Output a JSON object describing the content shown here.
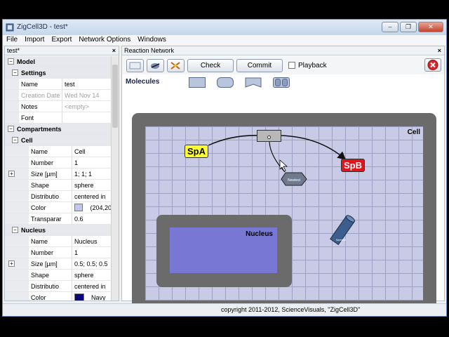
{
  "window": {
    "title": "ZigCell3D - test*"
  },
  "menu": [
    "File",
    "Import",
    "Export",
    "Network Options",
    "Windows"
  ],
  "left_panel": {
    "tab": "test*",
    "rows": [
      {
        "type": "group",
        "level": 0,
        "label": "Model"
      },
      {
        "type": "group",
        "level": 1,
        "label": "Settings"
      },
      {
        "type": "prop",
        "level": 1,
        "key": "Name",
        "value": "test"
      },
      {
        "type": "prop",
        "level": 1,
        "key": "Creation Date",
        "value": "Wed Nov 14",
        "muted": true
      },
      {
        "type": "prop",
        "level": 1,
        "key": "Notes",
        "value": "<empty>",
        "value_gray": true
      },
      {
        "type": "prop",
        "level": 1,
        "key": "Font",
        "value": ""
      },
      {
        "type": "group",
        "level": 0,
        "label": "Compartments"
      },
      {
        "type": "group",
        "level": 1,
        "label": "Cell"
      },
      {
        "type": "prop",
        "level": 2,
        "key": "Name",
        "value": "Cell"
      },
      {
        "type": "prop",
        "level": 2,
        "key": "Number",
        "value": "1"
      },
      {
        "type": "prop",
        "level": 2,
        "key": "Size [µm]",
        "value": "1; 1; 1",
        "expand": true
      },
      {
        "type": "prop",
        "level": 2,
        "key": "Shape",
        "value": "sphere"
      },
      {
        "type": "prop",
        "level": 2,
        "key": "Distributio",
        "value": "centered in"
      },
      {
        "type": "prop",
        "level": 2,
        "key": "Color",
        "value": "(204,20",
        "swatch": "#c4c6ee"
      },
      {
        "type": "prop",
        "level": 2,
        "key": "Transparar",
        "value": "0.6"
      },
      {
        "type": "group",
        "level": 1,
        "label": "Nucleus"
      },
      {
        "type": "prop",
        "level": 2,
        "key": "Name",
        "value": "Nucleus"
      },
      {
        "type": "prop",
        "level": 2,
        "key": "Number",
        "value": "1"
      },
      {
        "type": "prop",
        "level": 2,
        "key": "Size [µm]",
        "value": "0.5; 0.5; 0.5",
        "expand": true
      },
      {
        "type": "prop",
        "level": 2,
        "key": "Shape",
        "value": "sphere"
      },
      {
        "type": "prop",
        "level": 2,
        "key": "Distributio",
        "value": "centered in"
      },
      {
        "type": "prop",
        "level": 2,
        "key": "Color",
        "value": "Navy",
        "swatch": "#0a0a7a"
      }
    ]
  },
  "reaction_network": {
    "tab": "Reaction Network",
    "check_label": "Check",
    "commit_label": "Commit",
    "playback_label": "Playback",
    "molecules_label": "Molecules",
    "cell_label": "Cell",
    "nucleus_label": "Nucleus",
    "species": [
      {
        "name": "SpA",
        "color": "#ffff33",
        "text_color": "#000000"
      },
      {
        "name": "SpB",
        "color": "#e0141c",
        "text_color": "#ffffff"
      }
    ],
    "hexagon_label": "Newtest",
    "cylinder_label": "Newtest"
  },
  "status": {
    "copyright": "copyright 2011-2012, ScienceVisuals, \"ZigCell3D\""
  }
}
